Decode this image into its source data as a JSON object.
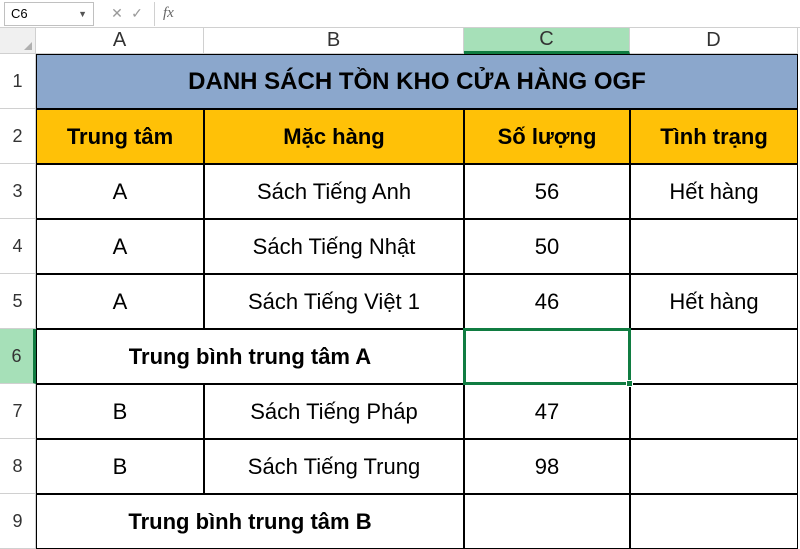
{
  "formula_bar": {
    "cell_ref": "C6",
    "fx_label": "fx",
    "formula_value": ""
  },
  "columns": [
    "A",
    "B",
    "C",
    "D"
  ],
  "rows": [
    "1",
    "2",
    "3",
    "4",
    "5",
    "6",
    "7",
    "8",
    "9"
  ],
  "title": "DANH SÁCH TỒN KHO CỬA HÀNG OGF",
  "headers": {
    "col1": "Trung tâm",
    "col2": "Mặc hàng",
    "col3": "Số lượng",
    "col4": "Tình trạng"
  },
  "data": [
    {
      "center": "A",
      "item": "Sách Tiếng Anh",
      "qty": "56",
      "status": "Hết hàng"
    },
    {
      "center": "A",
      "item": "Sách Tiếng Nhật",
      "qty": "50",
      "status": ""
    },
    {
      "center": "A",
      "item": "Sách Tiếng Việt 1",
      "qty": "46",
      "status": "Hết hàng"
    }
  ],
  "subtotal_a": "Trung bình trung tâm A",
  "data2": [
    {
      "center": "B",
      "item": "Sách Tiếng Pháp",
      "qty": "47",
      "status": ""
    },
    {
      "center": "B",
      "item": "Sách Tiếng Trung",
      "qty": "98",
      "status": ""
    }
  ],
  "subtotal_b": "Trung bình trung tâm B",
  "active_cell": "C6",
  "chart_data": {
    "type": "table",
    "title": "DANH SÁCH TỒN KHO CỬA HÀNG OGF",
    "columns": [
      "Trung tâm",
      "Mặc hàng",
      "Số lượng",
      "Tình trạng"
    ],
    "rows": [
      [
        "A",
        "Sách Tiếng Anh",
        56,
        "Hết hàng"
      ],
      [
        "A",
        "Sách Tiếng Nhật",
        50,
        ""
      ],
      [
        "A",
        "Sách Tiếng Việt 1",
        46,
        "Hết hàng"
      ],
      [
        "Trung bình trung tâm A",
        "",
        "",
        ""
      ],
      [
        "B",
        "Sách Tiếng Pháp",
        47,
        ""
      ],
      [
        "B",
        "Sách Tiếng Trung",
        98,
        ""
      ],
      [
        "Trung bình trung tâm B",
        "",
        "",
        ""
      ]
    ]
  }
}
